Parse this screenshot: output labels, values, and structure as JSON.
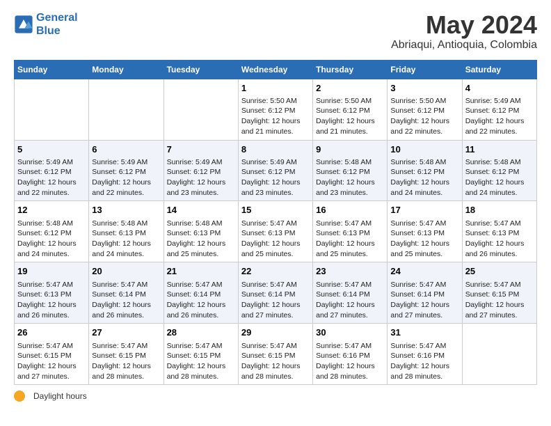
{
  "header": {
    "logo_line1": "General",
    "logo_line2": "Blue",
    "title": "May 2024",
    "subtitle": "Abriaqui, Antioquia, Colombia"
  },
  "weekdays": [
    "Sunday",
    "Monday",
    "Tuesday",
    "Wednesday",
    "Thursday",
    "Friday",
    "Saturday"
  ],
  "weeks": [
    [
      {
        "day": "",
        "info": ""
      },
      {
        "day": "",
        "info": ""
      },
      {
        "day": "",
        "info": ""
      },
      {
        "day": "1",
        "info": "Sunrise: 5:50 AM\nSunset: 6:12 PM\nDaylight: 12 hours\nand 21 minutes."
      },
      {
        "day": "2",
        "info": "Sunrise: 5:50 AM\nSunset: 6:12 PM\nDaylight: 12 hours\nand 21 minutes."
      },
      {
        "day": "3",
        "info": "Sunrise: 5:50 AM\nSunset: 6:12 PM\nDaylight: 12 hours\nand 22 minutes."
      },
      {
        "day": "4",
        "info": "Sunrise: 5:49 AM\nSunset: 6:12 PM\nDaylight: 12 hours\nand 22 minutes."
      }
    ],
    [
      {
        "day": "5",
        "info": "Sunrise: 5:49 AM\nSunset: 6:12 PM\nDaylight: 12 hours\nand 22 minutes."
      },
      {
        "day": "6",
        "info": "Sunrise: 5:49 AM\nSunset: 6:12 PM\nDaylight: 12 hours\nand 22 minutes."
      },
      {
        "day": "7",
        "info": "Sunrise: 5:49 AM\nSunset: 6:12 PM\nDaylight: 12 hours\nand 23 minutes."
      },
      {
        "day": "8",
        "info": "Sunrise: 5:49 AM\nSunset: 6:12 PM\nDaylight: 12 hours\nand 23 minutes."
      },
      {
        "day": "9",
        "info": "Sunrise: 5:48 AM\nSunset: 6:12 PM\nDaylight: 12 hours\nand 23 minutes."
      },
      {
        "day": "10",
        "info": "Sunrise: 5:48 AM\nSunset: 6:12 PM\nDaylight: 12 hours\nand 24 minutes."
      },
      {
        "day": "11",
        "info": "Sunrise: 5:48 AM\nSunset: 6:12 PM\nDaylight: 12 hours\nand 24 minutes."
      }
    ],
    [
      {
        "day": "12",
        "info": "Sunrise: 5:48 AM\nSunset: 6:12 PM\nDaylight: 12 hours\nand 24 minutes."
      },
      {
        "day": "13",
        "info": "Sunrise: 5:48 AM\nSunset: 6:13 PM\nDaylight: 12 hours\nand 24 minutes."
      },
      {
        "day": "14",
        "info": "Sunrise: 5:48 AM\nSunset: 6:13 PM\nDaylight: 12 hours\nand 25 minutes."
      },
      {
        "day": "15",
        "info": "Sunrise: 5:47 AM\nSunset: 6:13 PM\nDaylight: 12 hours\nand 25 minutes."
      },
      {
        "day": "16",
        "info": "Sunrise: 5:47 AM\nSunset: 6:13 PM\nDaylight: 12 hours\nand 25 minutes."
      },
      {
        "day": "17",
        "info": "Sunrise: 5:47 AM\nSunset: 6:13 PM\nDaylight: 12 hours\nand 25 minutes."
      },
      {
        "day": "18",
        "info": "Sunrise: 5:47 AM\nSunset: 6:13 PM\nDaylight: 12 hours\nand 26 minutes."
      }
    ],
    [
      {
        "day": "19",
        "info": "Sunrise: 5:47 AM\nSunset: 6:13 PM\nDaylight: 12 hours\nand 26 minutes."
      },
      {
        "day": "20",
        "info": "Sunrise: 5:47 AM\nSunset: 6:14 PM\nDaylight: 12 hours\nand 26 minutes."
      },
      {
        "day": "21",
        "info": "Sunrise: 5:47 AM\nSunset: 6:14 PM\nDaylight: 12 hours\nand 26 minutes."
      },
      {
        "day": "22",
        "info": "Sunrise: 5:47 AM\nSunset: 6:14 PM\nDaylight: 12 hours\nand 27 minutes."
      },
      {
        "day": "23",
        "info": "Sunrise: 5:47 AM\nSunset: 6:14 PM\nDaylight: 12 hours\nand 27 minutes."
      },
      {
        "day": "24",
        "info": "Sunrise: 5:47 AM\nSunset: 6:14 PM\nDaylight: 12 hours\nand 27 minutes."
      },
      {
        "day": "25",
        "info": "Sunrise: 5:47 AM\nSunset: 6:15 PM\nDaylight: 12 hours\nand 27 minutes."
      }
    ],
    [
      {
        "day": "26",
        "info": "Sunrise: 5:47 AM\nSunset: 6:15 PM\nDaylight: 12 hours\nand 27 minutes."
      },
      {
        "day": "27",
        "info": "Sunrise: 5:47 AM\nSunset: 6:15 PM\nDaylight: 12 hours\nand 28 minutes."
      },
      {
        "day": "28",
        "info": "Sunrise: 5:47 AM\nSunset: 6:15 PM\nDaylight: 12 hours\nand 28 minutes."
      },
      {
        "day": "29",
        "info": "Sunrise: 5:47 AM\nSunset: 6:15 PM\nDaylight: 12 hours\nand 28 minutes."
      },
      {
        "day": "30",
        "info": "Sunrise: 5:47 AM\nSunset: 6:16 PM\nDaylight: 12 hours\nand 28 minutes."
      },
      {
        "day": "31",
        "info": "Sunrise: 5:47 AM\nSunset: 6:16 PM\nDaylight: 12 hours\nand 28 minutes."
      },
      {
        "day": "",
        "info": ""
      }
    ]
  ],
  "footer": {
    "label": "Daylight hours"
  }
}
